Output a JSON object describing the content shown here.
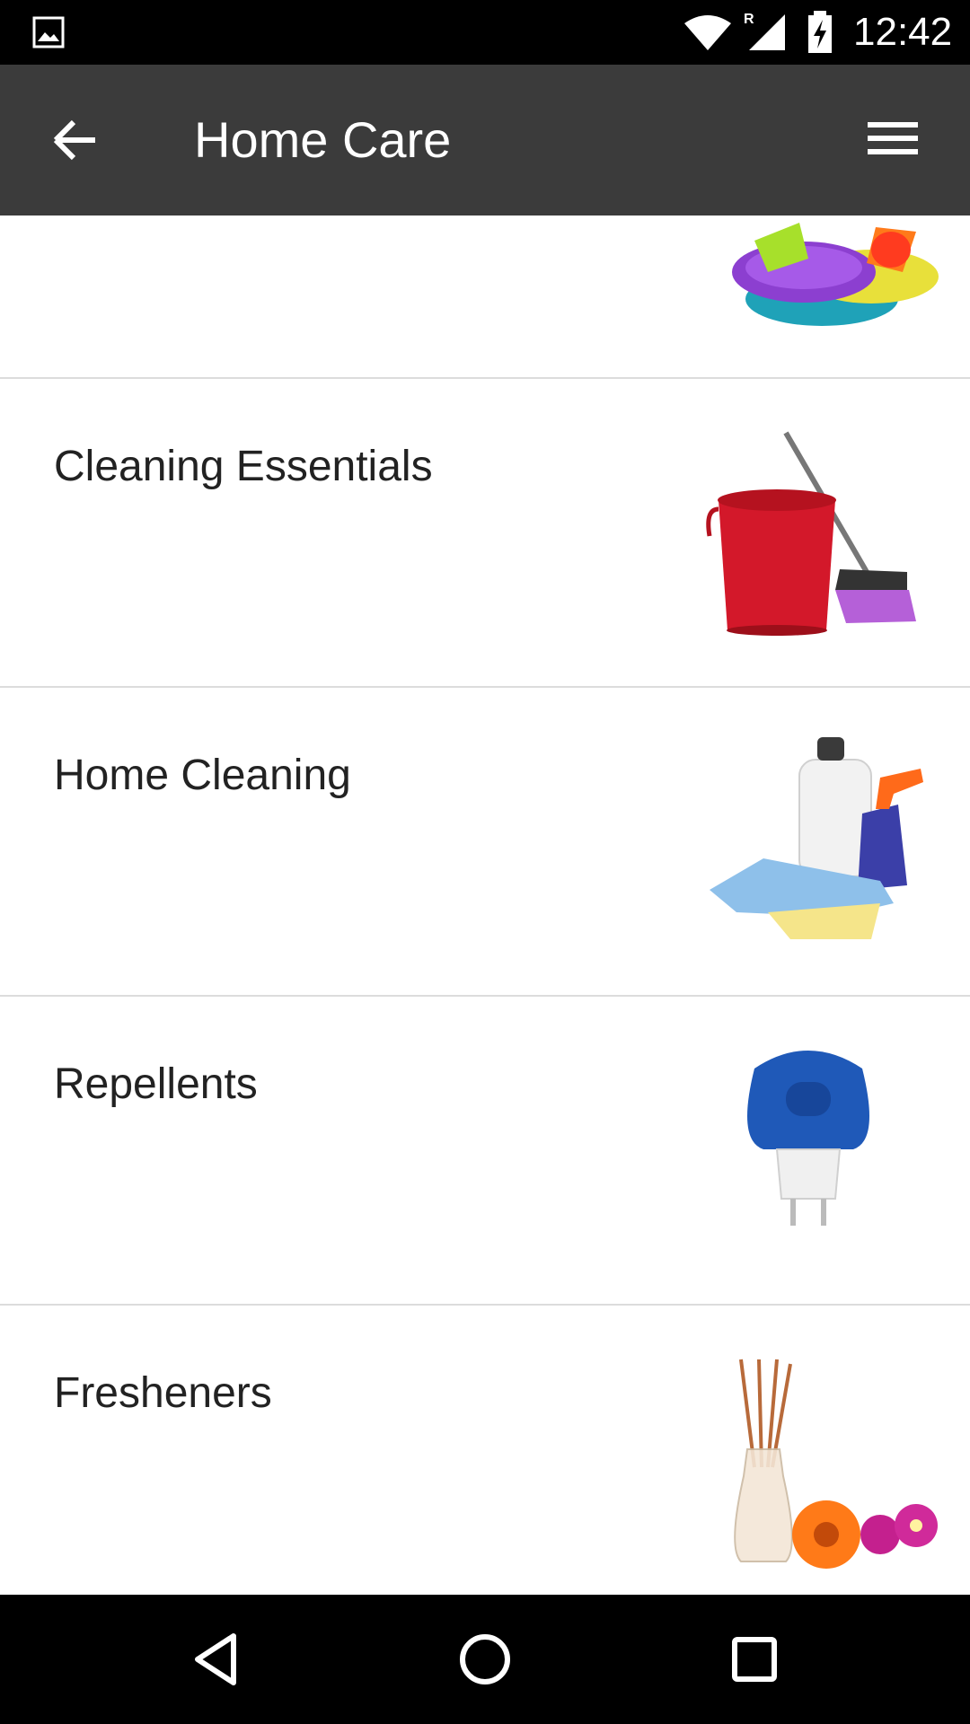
{
  "status_bar": {
    "time": "12:42",
    "icons": [
      "gallery-icon",
      "wifi-icon",
      "signal-icon",
      "battery-charging-icon"
    ]
  },
  "app_bar": {
    "title": "Home Care",
    "back_icon": "arrow-left-icon",
    "menu_icon": "hamburger-menu-icon"
  },
  "categories": [
    {
      "label": "",
      "image": "plastic-dishes-image"
    },
    {
      "label": "Cleaning Essentials",
      "image": "bucket-mop-image"
    },
    {
      "label": "Home Cleaning",
      "image": "cleaning-supplies-image"
    },
    {
      "label": "Repellents",
      "image": "mosquito-repellent-image"
    },
    {
      "label": "Fresheners",
      "image": "reed-diffuser-image"
    }
  ],
  "nav_bar": {
    "buttons": [
      "back-triangle-icon",
      "home-circle-icon",
      "recents-square-icon"
    ]
  }
}
